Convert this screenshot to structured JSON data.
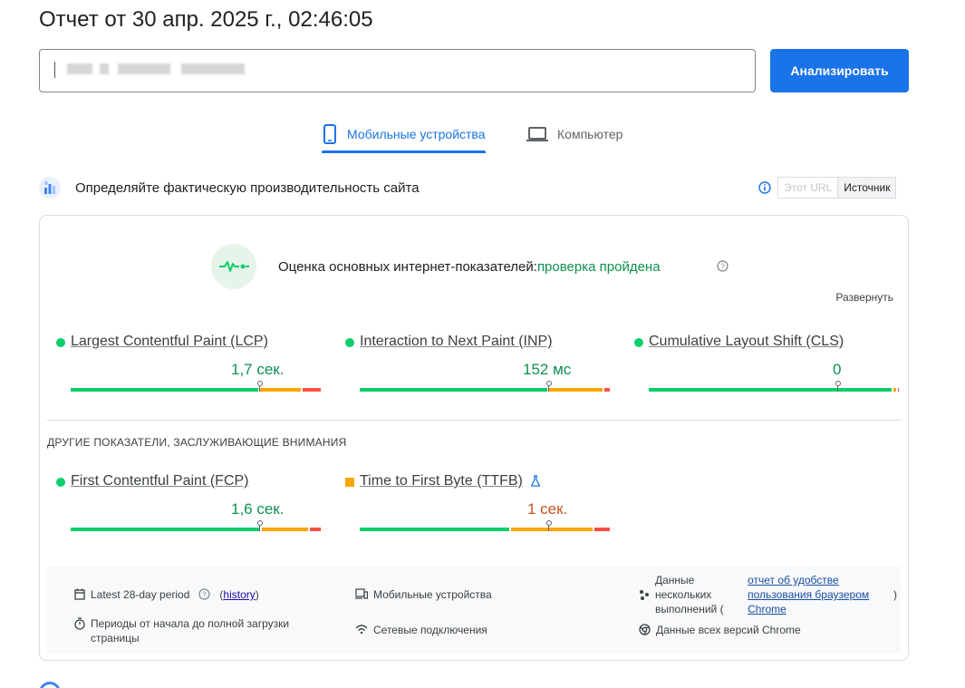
{
  "header": {
    "report_title": "Отчет от 30 апр. 2025 г., 02:46:05",
    "analyze_label": "Анализировать"
  },
  "tabs": [
    {
      "label": "Мобильные устройства",
      "active": true
    },
    {
      "label": "Компьютер",
      "active": false
    }
  ],
  "crux": {
    "title": "Определяйте фактическую производительность сайта",
    "toggle": [
      "Этот URL",
      "Источник"
    ],
    "assessment_label": "Оценка основных интернет-показателей:",
    "assessment_status": "проверка пройдена",
    "expand_label": "Развернуть"
  },
  "core_metrics": [
    {
      "name": "Largest Contentful Paint (LCP)",
      "value": "1,7 сек.",
      "status": "good",
      "marker": 0.75,
      "good_share": 0.75,
      "ni_share": 0.17,
      "poor_share": 0.08
    },
    {
      "name": "Interaction to Next Paint (INP)",
      "value": "152 мс",
      "status": "good",
      "marker": 0.75,
      "good_share": 0.75,
      "ni_share": 0.22,
      "poor_share": 0.03
    },
    {
      "name": "Cumulative Layout Shift (CLS)",
      "value": "0",
      "status": "good",
      "marker": 0.75,
      "good_share": 0.97,
      "ni_share": 0.02,
      "poor_share": 0.01
    }
  ],
  "other_metrics_title": "ДРУГИЕ ПОКАЗАТЕЛИ, ЗАСЛУЖИВАЮЩИЕ ВНИМАНИЯ",
  "other_metrics": [
    {
      "name": "First Contentful Paint (FCP)",
      "value": "1,6 сек.",
      "status": "good",
      "marker": 0.75,
      "good_share": 0.76,
      "ni_share": 0.19,
      "poor_share": 0.05
    },
    {
      "name": "Time to First Byte (TTFB)",
      "value": "1 сек.",
      "status": "ni",
      "marker": 0.75,
      "good_share": 0.6,
      "ni_share": 0.33,
      "poor_share": 0.07
    }
  ],
  "footer": {
    "period_label": "Latest 28-day period",
    "history_label": "history",
    "device_label": "Мобильные устройства",
    "samples_label": "Данные нескольких выполнений (",
    "crux_link": "отчет об удобстве пользования браузером Chrome",
    "close_paren": ")",
    "durations_label": "Периоды от начала до полной загрузки страницы",
    "network_label": "Сетевые подключения",
    "chrome_versions_label": "Данные всех версий Chrome",
    "open_paren": "(",
    "close_paren_history": ")"
  },
  "colors": {
    "good": "#0cce6b",
    "needs_improvement": "#ffa400",
    "poor": "#ff4e42",
    "accent": "#1a73e8"
  }
}
